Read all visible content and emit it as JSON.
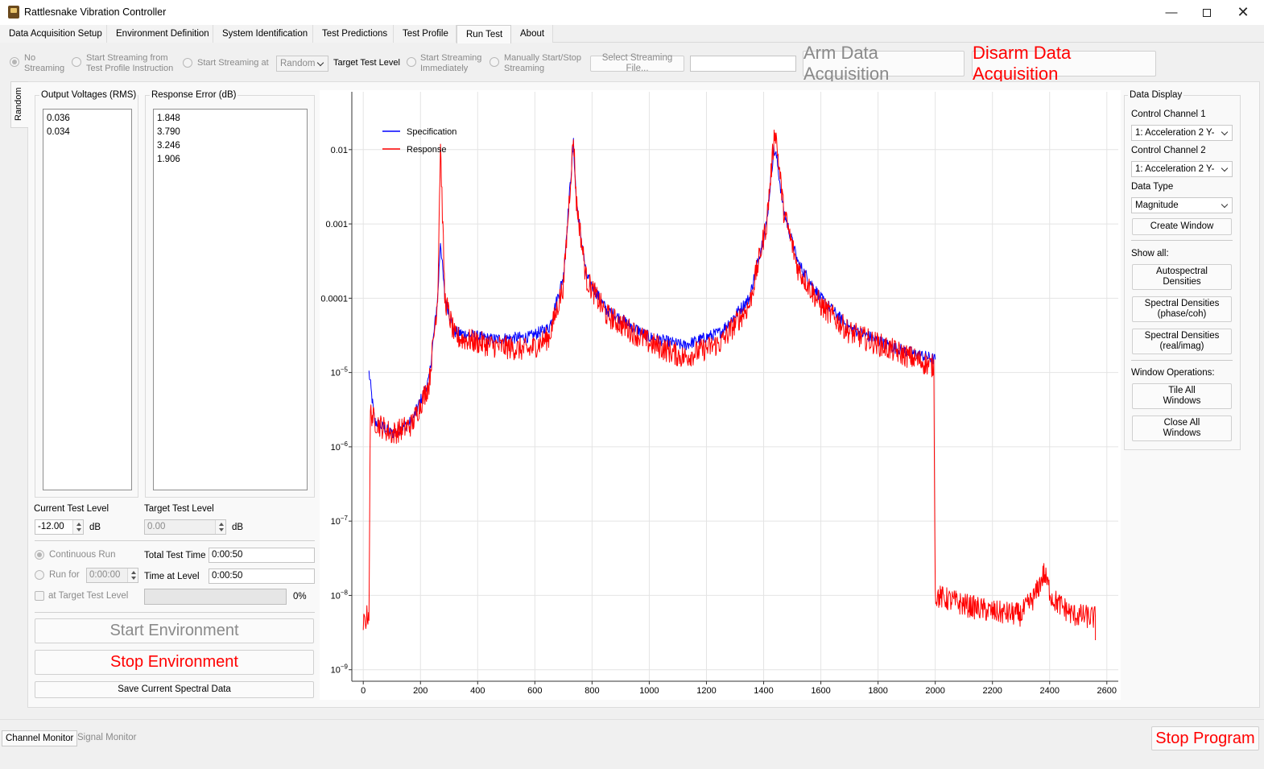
{
  "window": {
    "title": "Rattlesnake Vibration Controller"
  },
  "tabs": [
    "Data Acquisition Setup",
    "Environment Definition",
    "System Identification",
    "Test Predictions",
    "Test Profile",
    "Run Test",
    "About"
  ],
  "toolbar": {
    "no_streaming_l1": "No",
    "no_streaming_l2": "Streaming",
    "start_profile_l1": "Start Streaming from",
    "start_profile_l2": "Test Profile Instruction",
    "start_at": "Start Streaming at",
    "start_at_value": "Random",
    "target_level": "Target Test Level",
    "immediately_l1": "Start Streaming",
    "immediately_l2": "Immediately",
    "manual_l1": "Manually Start/Stop",
    "manual_l2": "Streaming",
    "select_file": "Select Streaming File...",
    "file_value": "",
    "arm": "Arm Data Acquisition",
    "disarm": "Disarm Data Acquisition"
  },
  "side_tab": "Random",
  "output_voltages": {
    "title": "Output Voltages (RMS)",
    "values": [
      "0.036",
      "0.034"
    ]
  },
  "response_error": {
    "title": "Response Error (dB)",
    "values": [
      "1.848",
      "3.790",
      "3.246",
      "1.906"
    ]
  },
  "levels": {
    "current_label": "Current Test Level",
    "current_value": "-12.00",
    "current_unit": "dB",
    "target_label": "Target Test Level",
    "target_value": "0.00",
    "target_unit": "dB"
  },
  "run": {
    "continuous": "Continuous Run",
    "run_for": "Run for",
    "run_for_value": "0:00:00",
    "at_target": "at Target Test Level",
    "total_time_label": "Total Test Time",
    "total_time_value": "0:00:50",
    "time_at_level_label": "Time at Level",
    "time_at_level_value": "0:00:50",
    "progress": 0,
    "progress_text": "0%"
  },
  "buttons": {
    "start_env": "Start Environment",
    "stop_env": "Stop Environment",
    "save_spectral": "Save Current Spectral Data",
    "stop_program": "Stop Program"
  },
  "data_display": {
    "title": "Data Display",
    "ctrl1_label": "Control Channel 1",
    "ctrl1_value": "1: Acceleration 2 Y-",
    "ctrl2_label": "Control Channel 2",
    "ctrl2_value": "1: Acceleration 2 Y-",
    "dtype_label": "Data Type",
    "dtype_value": "Magnitude",
    "create_window": "Create Window",
    "show_all": "Show all:",
    "asd_l1": "Autospectral",
    "asd_l2": "Densities",
    "sdpc_l1": "Spectral Densities",
    "sdpc_l2": "(phase/coh)",
    "sdri_l1": "Spectral Densities",
    "sdri_l2": "(real/imag)",
    "win_ops": "Window Operations:",
    "tile_l1": "Tile All",
    "tile_l2": "Windows",
    "close_l1": "Close All",
    "close_l2": "Windows"
  },
  "bottom_tabs": [
    "Channel Monitor",
    "Signal Monitor"
  ],
  "colors": {
    "specification": "#0000ff",
    "response": "#ff0000",
    "red_text": "#ff0000"
  },
  "chart_data": {
    "type": "line",
    "y_scale": "log",
    "xlim": [
      -40,
      2640
    ],
    "ylim": [
      7e-10,
      0.06
    ],
    "x_ticks": [
      0,
      200,
      400,
      600,
      800,
      1000,
      1200,
      1400,
      1600,
      1800,
      2000,
      2200,
      2400,
      2600
    ],
    "y_ticks": [
      {
        "v": 0.01,
        "label": "0.01"
      },
      {
        "v": 0.001,
        "label": "0.001"
      },
      {
        "v": 0.0001,
        "label": "0.0001"
      },
      {
        "v": 1e-05,
        "base": "10",
        "exp": "−5"
      },
      {
        "v": 1e-06,
        "base": "10",
        "exp": "−6"
      },
      {
        "v": 1e-07,
        "base": "10",
        "exp": "−7"
      },
      {
        "v": 1e-08,
        "base": "10",
        "exp": "−8"
      },
      {
        "v": 1e-09,
        "base": "10",
        "exp": "−9"
      }
    ],
    "grid": true,
    "legend_position": "top-left",
    "series": [
      {
        "name": "Specification",
        "color": "#0000ff",
        "points": [
          [
            20,
            1e-05
          ],
          [
            40,
            2.2e-06
          ],
          [
            100,
            1.5e-06
          ],
          [
            170,
            2.2e-06
          ],
          [
            230,
            8e-06
          ],
          [
            260,
            0.0001
          ],
          [
            270,
            0.0006
          ],
          [
            285,
            0.0001
          ],
          [
            320,
            3.5e-05
          ],
          [
            450,
            2.8e-05
          ],
          [
            580,
            3e-05
          ],
          [
            650,
            4e-05
          ],
          [
            700,
            0.0002
          ],
          [
            725,
            0.004
          ],
          [
            735,
            0.012
          ],
          [
            745,
            0.002
          ],
          [
            780,
            0.0002
          ],
          [
            850,
            7e-05
          ],
          [
            1000,
            3e-05
          ],
          [
            1120,
            2.3e-05
          ],
          [
            1250,
            3.5e-05
          ],
          [
            1350,
            0.0001
          ],
          [
            1410,
            0.001
          ],
          [
            1435,
            0.01
          ],
          [
            1445,
            0.008
          ],
          [
            1470,
            0.0015
          ],
          [
            1520,
            0.0003
          ],
          [
            1600,
            0.0001
          ],
          [
            1700,
            4e-05
          ],
          [
            1850,
            2.2e-05
          ],
          [
            2000,
            1.5e-05
          ]
        ]
      },
      {
        "name": "Response",
        "color": "#ff0000",
        "points": [
          [
            0,
            4e-09
          ],
          [
            20,
            6e-09
          ],
          [
            25,
            3e-06
          ],
          [
            40,
            2.2e-06
          ],
          [
            100,
            1.5e-06
          ],
          [
            170,
            2e-06
          ],
          [
            230,
            7e-06
          ],
          [
            260,
            0.0001
          ],
          [
            270,
            0.012
          ],
          [
            285,
            0.0001
          ],
          [
            320,
            3e-05
          ],
          [
            450,
            2.3e-05
          ],
          [
            580,
            2e-05
          ],
          [
            650,
            3e-05
          ],
          [
            700,
            0.00015
          ],
          [
            725,
            0.004
          ],
          [
            735,
            0.015
          ],
          [
            745,
            0.002
          ],
          [
            780,
            0.00018
          ],
          [
            850,
            6e-05
          ],
          [
            1000,
            2.5e-05
          ],
          [
            1120,
            1.6e-05
          ],
          [
            1250,
            2.5e-05
          ],
          [
            1350,
            8e-05
          ],
          [
            1410,
            0.001
          ],
          [
            1440,
            0.02
          ],
          [
            1470,
            0.0015
          ],
          [
            1520,
            0.00025
          ],
          [
            1600,
            8e-05
          ],
          [
            1700,
            3.5e-05
          ],
          [
            1850,
            2e-05
          ],
          [
            1995,
            1.2e-05
          ],
          [
            2000,
            1e-08
          ],
          [
            2100,
            7.5e-09
          ],
          [
            2200,
            6e-09
          ],
          [
            2300,
            5.5e-09
          ],
          [
            2350,
            1e-08
          ],
          [
            2380,
            2e-08
          ],
          [
            2410,
            9e-09
          ],
          [
            2480,
            5.5e-09
          ],
          [
            2560,
            5e-09
          ]
        ]
      }
    ]
  }
}
